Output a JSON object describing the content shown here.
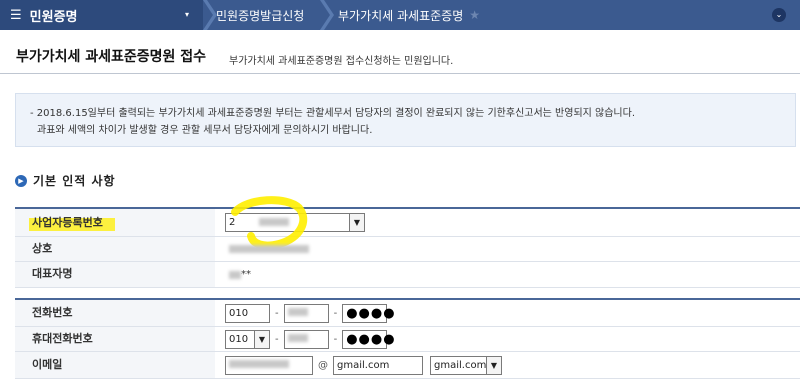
{
  "topnav": {
    "menu_icon": "hamburger-icon",
    "menu_title": "민원증명",
    "caret": "▾",
    "crumbs": [
      "민원증명발급신청",
      "부가가치세 과세표준증명"
    ],
    "star": "★",
    "expand": "⌄"
  },
  "header": {
    "title": "부가가치세 과세표준증명원 접수",
    "description": "부가가치세 과세표준증명원 접수신청하는 민원입니다."
  },
  "notice": {
    "line1": "- 2018.6.15일부터 출력되는 부가가치세 과세표준증명원 부터는 관할세무서 담당자의 결정이 완료되지 않는 기한후신고서는 반영되지 않습니다.",
    "line2": "과표와 세액의 차이가 발생할 경우 관할 세무서 담당자에게 문의하시기 바랍니다."
  },
  "section": {
    "title": "기본 인적 사항"
  },
  "basic_info": {
    "business_number_label": "사업자등록번호",
    "business_number_value": "2",
    "company_label": "상호",
    "representative_label": "대표자명",
    "representative_suffix": "**"
  },
  "contact": {
    "phone_label": "전화번호",
    "phone_prefix": "010",
    "phone_last": "●●●●",
    "mobile_label": "휴대전화번호",
    "mobile_prefix": "010",
    "mobile_last": "●●●●",
    "email_label": "이메일",
    "email_at": "@",
    "email_domain": "gmail.com",
    "email_domain_select": "gmail.com",
    "dash": "-"
  },
  "colors": {
    "nav_bg": "#3b5a8f",
    "highlight": "#ffee00",
    "section_dot": "#2d68b6"
  }
}
